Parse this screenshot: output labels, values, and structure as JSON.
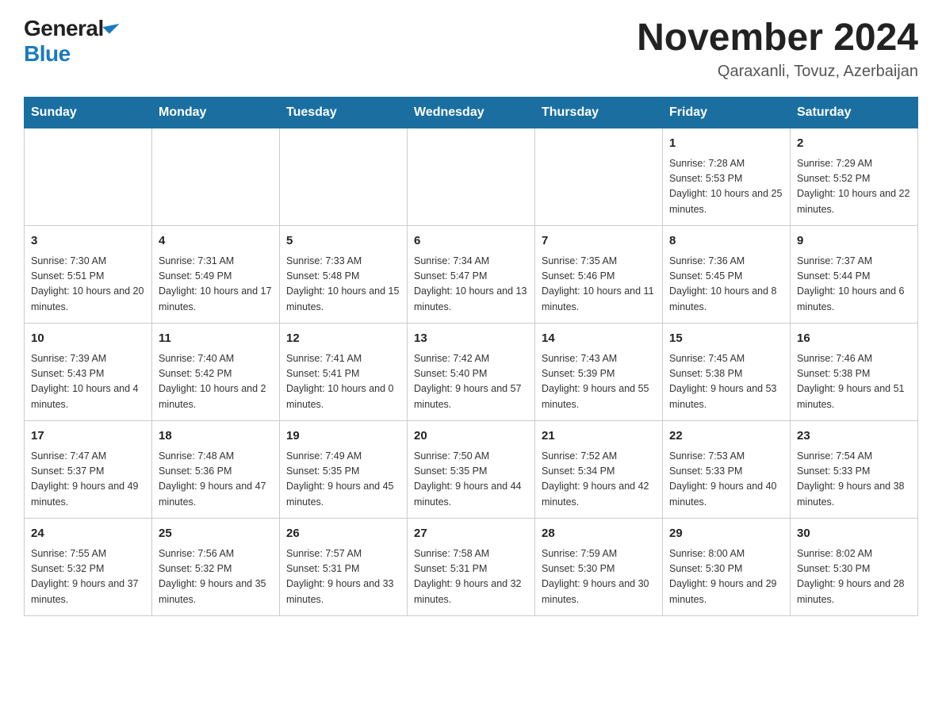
{
  "header": {
    "logo_general": "General",
    "logo_blue": "Blue",
    "month_title": "November 2024",
    "location": "Qaraxanli, Tovuz, Azerbaijan"
  },
  "days_of_week": [
    "Sunday",
    "Monday",
    "Tuesday",
    "Wednesday",
    "Thursday",
    "Friday",
    "Saturday"
  ],
  "weeks": [
    {
      "days": [
        {
          "number": "",
          "info": ""
        },
        {
          "number": "",
          "info": ""
        },
        {
          "number": "",
          "info": ""
        },
        {
          "number": "",
          "info": ""
        },
        {
          "number": "",
          "info": ""
        },
        {
          "number": "1",
          "info": "Sunrise: 7:28 AM\nSunset: 5:53 PM\nDaylight: 10 hours and 25 minutes."
        },
        {
          "number": "2",
          "info": "Sunrise: 7:29 AM\nSunset: 5:52 PM\nDaylight: 10 hours and 22 minutes."
        }
      ]
    },
    {
      "days": [
        {
          "number": "3",
          "info": "Sunrise: 7:30 AM\nSunset: 5:51 PM\nDaylight: 10 hours and 20 minutes."
        },
        {
          "number": "4",
          "info": "Sunrise: 7:31 AM\nSunset: 5:49 PM\nDaylight: 10 hours and 17 minutes."
        },
        {
          "number": "5",
          "info": "Sunrise: 7:33 AM\nSunset: 5:48 PM\nDaylight: 10 hours and 15 minutes."
        },
        {
          "number": "6",
          "info": "Sunrise: 7:34 AM\nSunset: 5:47 PM\nDaylight: 10 hours and 13 minutes."
        },
        {
          "number": "7",
          "info": "Sunrise: 7:35 AM\nSunset: 5:46 PM\nDaylight: 10 hours and 11 minutes."
        },
        {
          "number": "8",
          "info": "Sunrise: 7:36 AM\nSunset: 5:45 PM\nDaylight: 10 hours and 8 minutes."
        },
        {
          "number": "9",
          "info": "Sunrise: 7:37 AM\nSunset: 5:44 PM\nDaylight: 10 hours and 6 minutes."
        }
      ]
    },
    {
      "days": [
        {
          "number": "10",
          "info": "Sunrise: 7:39 AM\nSunset: 5:43 PM\nDaylight: 10 hours and 4 minutes."
        },
        {
          "number": "11",
          "info": "Sunrise: 7:40 AM\nSunset: 5:42 PM\nDaylight: 10 hours and 2 minutes."
        },
        {
          "number": "12",
          "info": "Sunrise: 7:41 AM\nSunset: 5:41 PM\nDaylight: 10 hours and 0 minutes."
        },
        {
          "number": "13",
          "info": "Sunrise: 7:42 AM\nSunset: 5:40 PM\nDaylight: 9 hours and 57 minutes."
        },
        {
          "number": "14",
          "info": "Sunrise: 7:43 AM\nSunset: 5:39 PM\nDaylight: 9 hours and 55 minutes."
        },
        {
          "number": "15",
          "info": "Sunrise: 7:45 AM\nSunset: 5:38 PM\nDaylight: 9 hours and 53 minutes."
        },
        {
          "number": "16",
          "info": "Sunrise: 7:46 AM\nSunset: 5:38 PM\nDaylight: 9 hours and 51 minutes."
        }
      ]
    },
    {
      "days": [
        {
          "number": "17",
          "info": "Sunrise: 7:47 AM\nSunset: 5:37 PM\nDaylight: 9 hours and 49 minutes."
        },
        {
          "number": "18",
          "info": "Sunrise: 7:48 AM\nSunset: 5:36 PM\nDaylight: 9 hours and 47 minutes."
        },
        {
          "number": "19",
          "info": "Sunrise: 7:49 AM\nSunset: 5:35 PM\nDaylight: 9 hours and 45 minutes."
        },
        {
          "number": "20",
          "info": "Sunrise: 7:50 AM\nSunset: 5:35 PM\nDaylight: 9 hours and 44 minutes."
        },
        {
          "number": "21",
          "info": "Sunrise: 7:52 AM\nSunset: 5:34 PM\nDaylight: 9 hours and 42 minutes."
        },
        {
          "number": "22",
          "info": "Sunrise: 7:53 AM\nSunset: 5:33 PM\nDaylight: 9 hours and 40 minutes."
        },
        {
          "number": "23",
          "info": "Sunrise: 7:54 AM\nSunset: 5:33 PM\nDaylight: 9 hours and 38 minutes."
        }
      ]
    },
    {
      "days": [
        {
          "number": "24",
          "info": "Sunrise: 7:55 AM\nSunset: 5:32 PM\nDaylight: 9 hours and 37 minutes."
        },
        {
          "number": "25",
          "info": "Sunrise: 7:56 AM\nSunset: 5:32 PM\nDaylight: 9 hours and 35 minutes."
        },
        {
          "number": "26",
          "info": "Sunrise: 7:57 AM\nSunset: 5:31 PM\nDaylight: 9 hours and 33 minutes."
        },
        {
          "number": "27",
          "info": "Sunrise: 7:58 AM\nSunset: 5:31 PM\nDaylight: 9 hours and 32 minutes."
        },
        {
          "number": "28",
          "info": "Sunrise: 7:59 AM\nSunset: 5:30 PM\nDaylight: 9 hours and 30 minutes."
        },
        {
          "number": "29",
          "info": "Sunrise: 8:00 AM\nSunset: 5:30 PM\nDaylight: 9 hours and 29 minutes."
        },
        {
          "number": "30",
          "info": "Sunrise: 8:02 AM\nSunset: 5:30 PM\nDaylight: 9 hours and 28 minutes."
        }
      ]
    }
  ]
}
